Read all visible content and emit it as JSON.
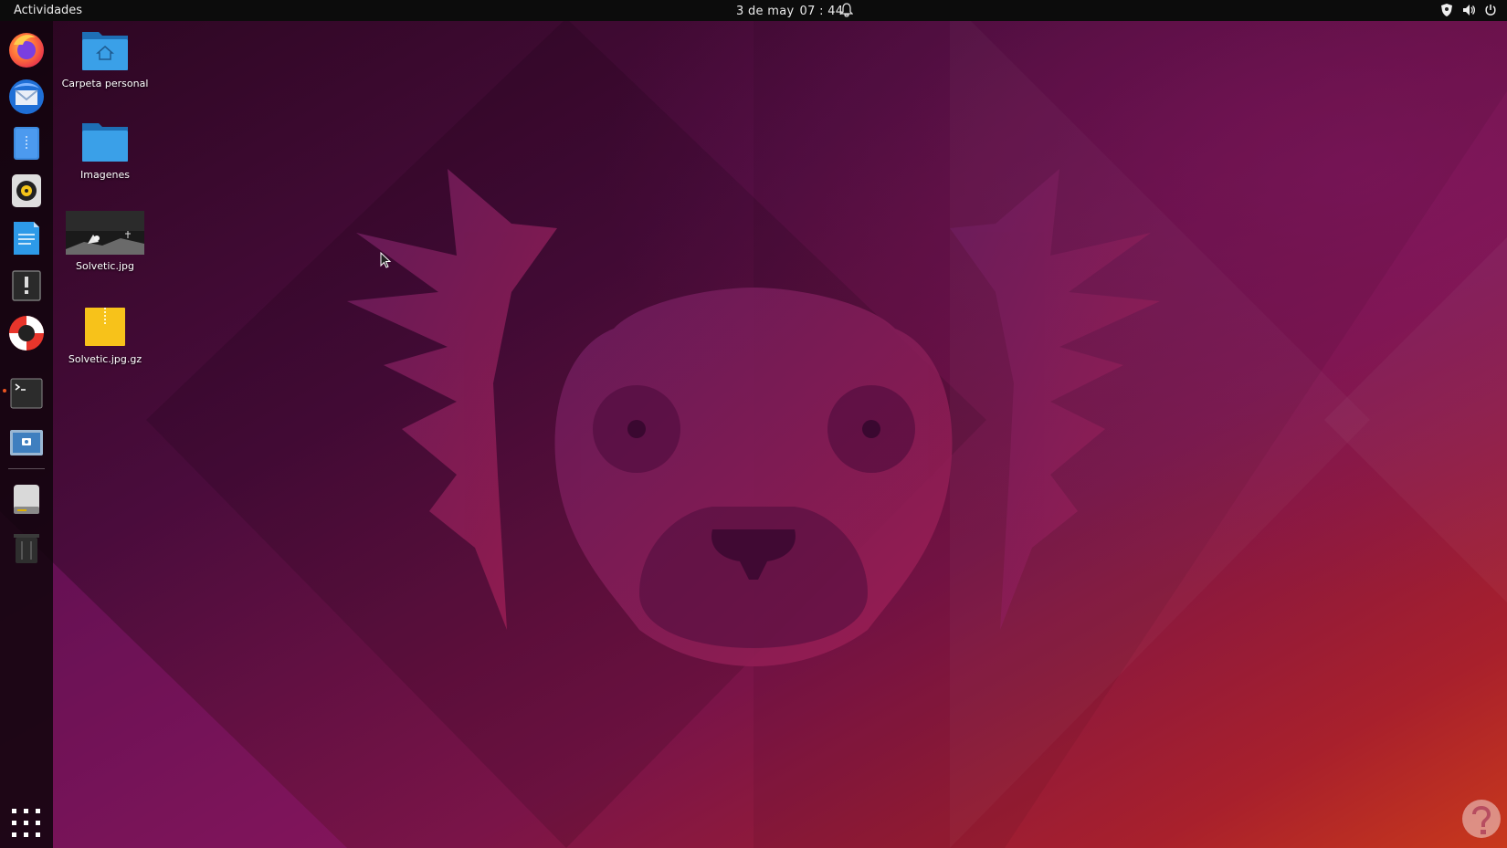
{
  "topbar": {
    "activities": "Actividades",
    "date": "3 de may",
    "time": "07 : 44",
    "tray_icons": [
      "shield-icon",
      "volume-icon",
      "power-icon"
    ]
  },
  "dock": {
    "items": [
      {
        "name": "firefox-icon"
      },
      {
        "name": "thunderbird-icon"
      },
      {
        "name": "files-icon"
      },
      {
        "name": "rhythmbox-icon"
      },
      {
        "name": "writer-icon"
      },
      {
        "name": "software-icon"
      },
      {
        "name": "help-icon"
      },
      {
        "name": "terminal-icon",
        "running": true
      },
      {
        "name": "screenshot-icon"
      },
      {
        "name": "drive-icon"
      },
      {
        "name": "trash-icon"
      }
    ],
    "show_apps_icon": "app-grid-icon"
  },
  "desktop": {
    "icons": [
      {
        "label": "Carpeta personal",
        "icon": "home-folder-icon"
      },
      {
        "label": "Imagenes",
        "icon": "folder-icon"
      },
      {
        "label": "Solvetic.jpg",
        "icon": "image-thumbnail"
      },
      {
        "label": "Solvetic.jpg.gz",
        "icon": "archive-icon"
      }
    ]
  },
  "colors": {
    "accent": "#e95420",
    "topbar": "#0c0c0c",
    "wallpaper_dark": "#2a0620",
    "wallpaper_mid": "#7a1448",
    "wallpaper_warm": "#c0281e"
  }
}
